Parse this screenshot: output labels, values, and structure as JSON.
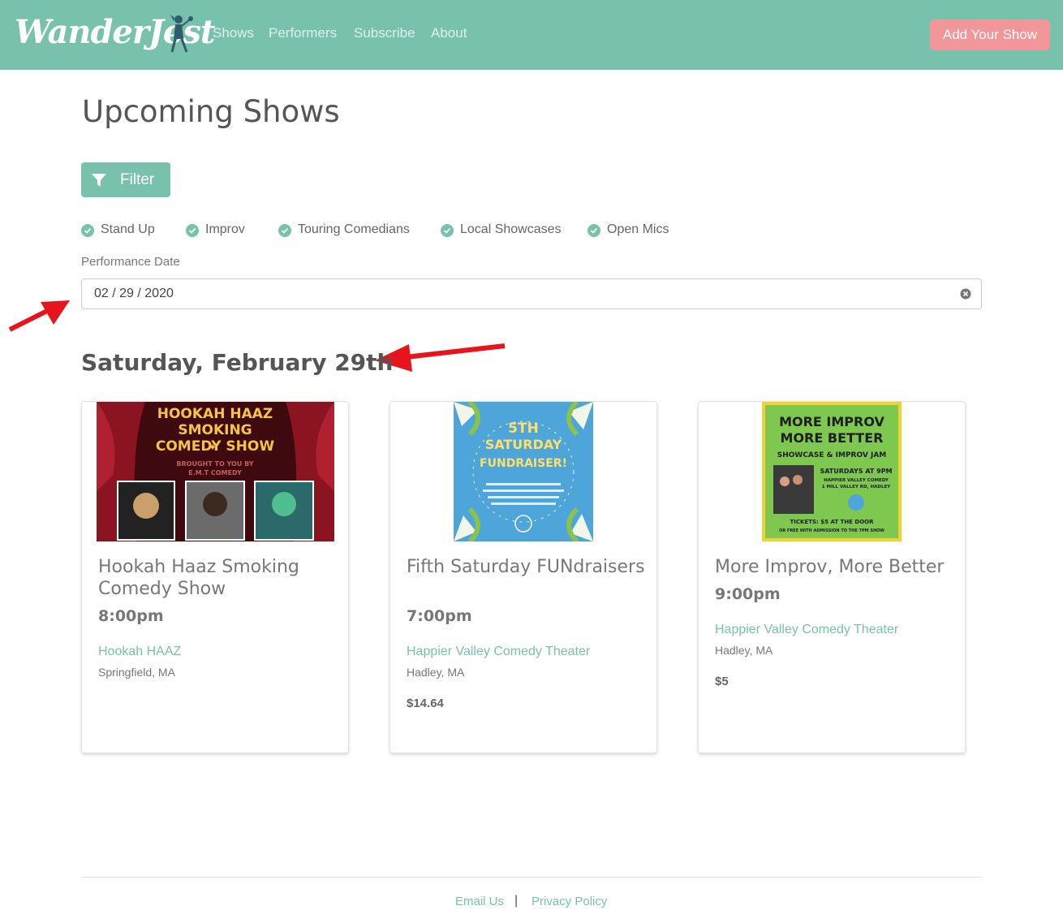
{
  "brand": {
    "logo_text": "WanderJest"
  },
  "nav": {
    "links": [
      "Shows",
      "Performers",
      "Subscribe",
      "About"
    ],
    "cta_label": "Add Your Show"
  },
  "page": {
    "title": "Upcoming Shows"
  },
  "filter": {
    "button_label": "Filter",
    "categories": [
      {
        "label": "Stand Up",
        "checked": true
      },
      {
        "label": "Improv",
        "checked": true
      },
      {
        "label": "Touring Comedians",
        "checked": true
      },
      {
        "label": "Local Showcases",
        "checked": true
      },
      {
        "label": "Open Mics",
        "checked": true
      }
    ],
    "date_label": "Performance Date",
    "date_value": "02 / 29 / 2020"
  },
  "day_heading": "Saturday, February 29th",
  "shows": [
    {
      "title": "Hookah Haaz Smoking Comedy Show",
      "time": "8:00pm",
      "venue": "Hookah HAAZ",
      "city": "Springfield, MA",
      "price": "",
      "poster": {
        "headline": [
          "HOOKAH HAAZ",
          "SMOKING",
          "COMEDY SHOW"
        ],
        "byline": [
          "BROUGHT TO YOU BY",
          "E.M.T COMEDY"
        ]
      }
    },
    {
      "title": "Fifth Saturday FUNdraisers",
      "time": "7:00pm",
      "venue": "Happier Valley Comedy Theater",
      "city": "Hadley, MA",
      "price": "$14.64",
      "poster": {
        "headline": [
          "5TH",
          "SATURDAY",
          "FUNDRAISER!"
        ]
      }
    },
    {
      "title": "More Improv, More Better",
      "time": "9:00pm",
      "venue": "Happier Valley Comedy Theater",
      "city": "Hadley, MA",
      "price": "$5",
      "poster": {
        "headline": [
          "MORE IMPROV",
          "MORE BETTER",
          "SHOWCASE & IMPROV JAM"
        ],
        "sub": [
          "SATURDAYS AT 9PM",
          "HAPPIER VALLEY COMEDY",
          "1 MILL VALLEY RD, HADLEY"
        ],
        "footer": [
          "TICKETS: $5 AT THE DOOR",
          "OR FREE WITH ADMISSION TO THE 7PM SHOW"
        ]
      }
    }
  ],
  "footer": {
    "email_label": "Email Us",
    "separator": "|",
    "privacy_label": "Privacy Policy"
  },
  "colors": {
    "primary": "#78c2ad",
    "secondary": "#f3969a",
    "annotation_arrow": "#e8141b"
  }
}
